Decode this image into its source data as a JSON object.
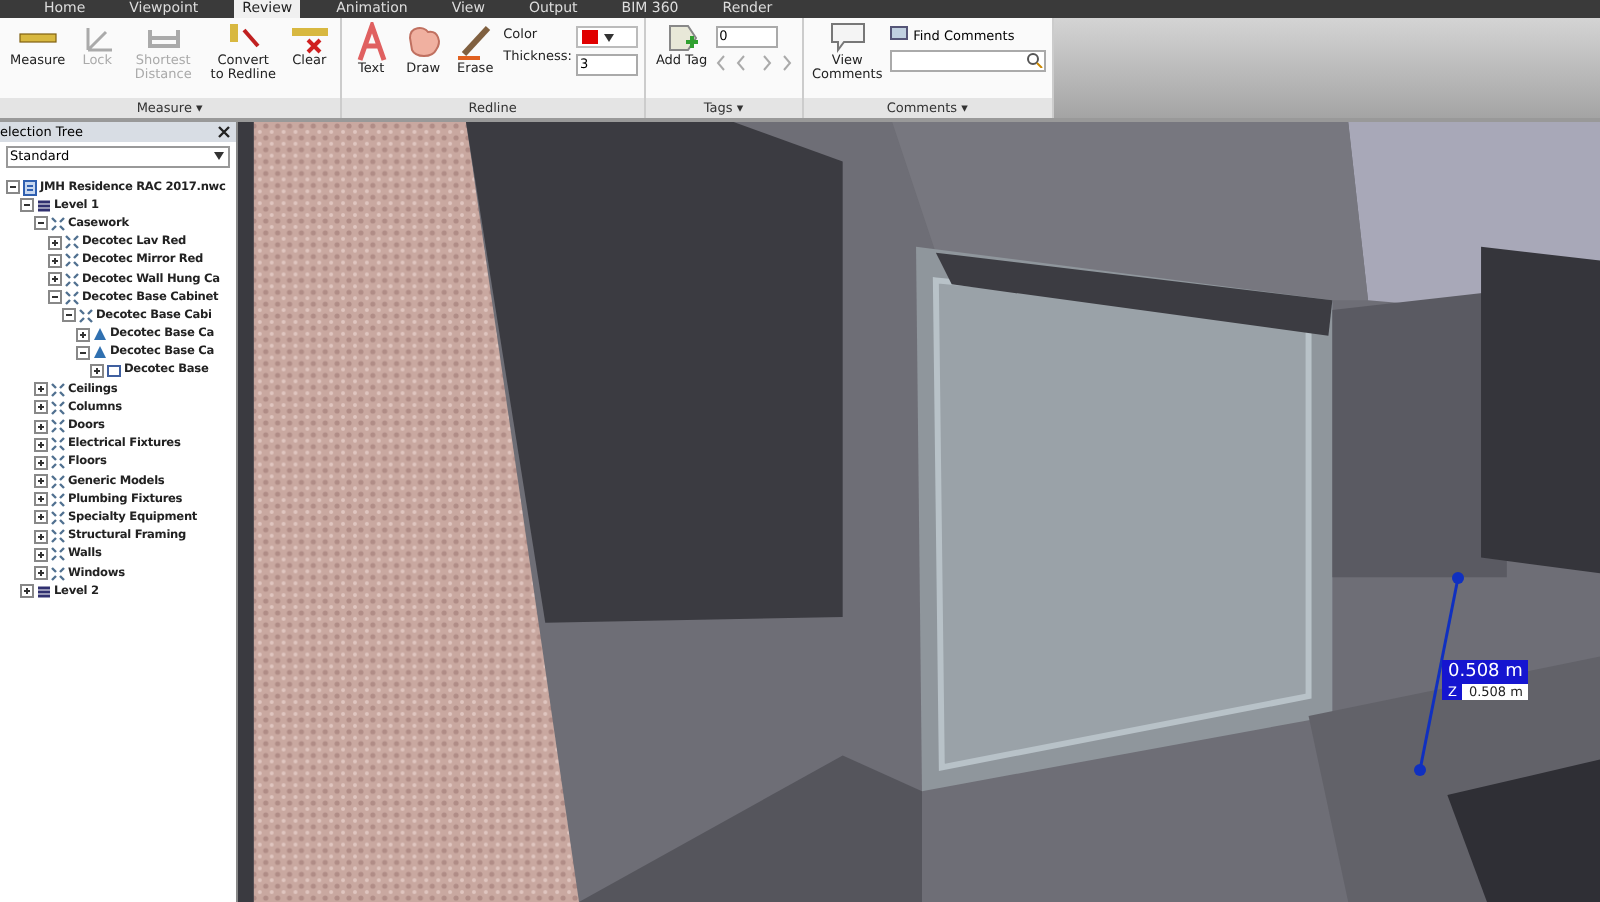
{
  "ribbon_tabs": [
    {
      "label": "Home",
      "selected": false
    },
    {
      "label": "Viewpoint",
      "selected": false
    },
    {
      "label": "Review",
      "selected": true
    },
    {
      "label": "Animation",
      "selected": false
    },
    {
      "label": "View",
      "selected": false
    },
    {
      "label": "Output",
      "selected": false
    },
    {
      "label": "BIM 360",
      "selected": false
    },
    {
      "label": "Render",
      "selected": false
    }
  ],
  "measure_panel": {
    "title": "Measure ▾",
    "tools": [
      {
        "kind": "measure",
        "label": "Measure",
        "disabled": false
      },
      {
        "kind": "lock",
        "label": "Lock",
        "disabled": true
      },
      {
        "kind": "shortest",
        "label": "Shortest Distance",
        "disabled": true
      },
      {
        "kind": "convert",
        "label": "Convert to Redline",
        "disabled": false
      },
      {
        "kind": "clear",
        "label": "Clear",
        "disabled": false
      }
    ]
  },
  "redline_panel": {
    "title": "Redline",
    "tools": [
      {
        "kind": "text",
        "label": "Text"
      },
      {
        "kind": "draw",
        "label": "Draw"
      },
      {
        "kind": "erase",
        "label": "Erase"
      }
    ],
    "color_label": "Color",
    "color": "#e00000",
    "thickness_label": "Thickness:",
    "thickness": "3"
  },
  "tags_panel": {
    "title": "Tags ▾",
    "add_label": "Add Tag",
    "tag_value": "0"
  },
  "comments_panel": {
    "title": "Comments ▾",
    "view_label": "View Comments",
    "find_label": "Find Comments"
  },
  "selection_tree": {
    "title": "election Tree",
    "dropdown": "Standard",
    "items": [
      {
        "kind": "file",
        "label": "JMH Residence RAC 2017.nwc",
        "expanded": true,
        "children": [
          {
            "kind": "level",
            "label": "Level 1",
            "expanded": true,
            "children": [
              {
                "kind": "group",
                "label": "Casework",
                "expanded": true,
                "children": [
                  {
                    "kind": "group",
                    "label": "Decotec Lav Red",
                    "expanded": false
                  },
                  {
                    "kind": "group",
                    "label": "Decotec Mirror Red",
                    "expanded": false
                  },
                  {
                    "kind": "group",
                    "label": "Decotec Wall Hung Ca",
                    "expanded": false
                  },
                  {
                    "kind": "group",
                    "label": "Decotec Base Cabinet",
                    "expanded": true,
                    "children": [
                      {
                        "kind": "group",
                        "label": "Decotec Base Cabi",
                        "expanded": true,
                        "children": [
                          {
                            "kind": "instance",
                            "label": "Decotec Base Ca",
                            "expanded": false
                          },
                          {
                            "kind": "instance",
                            "label": "Decotec Base Ca",
                            "expanded": true,
                            "children": [
                              {
                                "kind": "geometry",
                                "label": "Decotec Base",
                                "expanded": false
                              }
                            ]
                          }
                        ]
                      }
                    ]
                  }
                ]
              },
              {
                "kind": "group",
                "label": "Ceilings",
                "expanded": false
              },
              {
                "kind": "group",
                "label": "Columns",
                "expanded": false
              },
              {
                "kind": "group",
                "label": "Doors",
                "expanded": false
              },
              {
                "kind": "group",
                "label": "Electrical Fixtures",
                "expanded": false
              },
              {
                "kind": "group",
                "label": "Floors",
                "expanded": false
              },
              {
                "kind": "group",
                "label": "Generic Models",
                "expanded": false
              },
              {
                "kind": "group",
                "label": "Plumbing Fixtures",
                "expanded": false
              },
              {
                "kind": "group",
                "label": "Specialty Equipment",
                "expanded": false
              },
              {
                "kind": "group",
                "label": "Structural Framing",
                "expanded": false
              },
              {
                "kind": "group",
                "label": "Walls",
                "expanded": false
              },
              {
                "kind": "group",
                "label": "Windows",
                "expanded": false
              }
            ]
          },
          {
            "kind": "level",
            "label": "Level 2",
            "expanded": false
          }
        ]
      }
    ]
  },
  "measurement": {
    "distance": "0.508 m",
    "axis": "Z",
    "axis_distance": "0.508 m"
  }
}
